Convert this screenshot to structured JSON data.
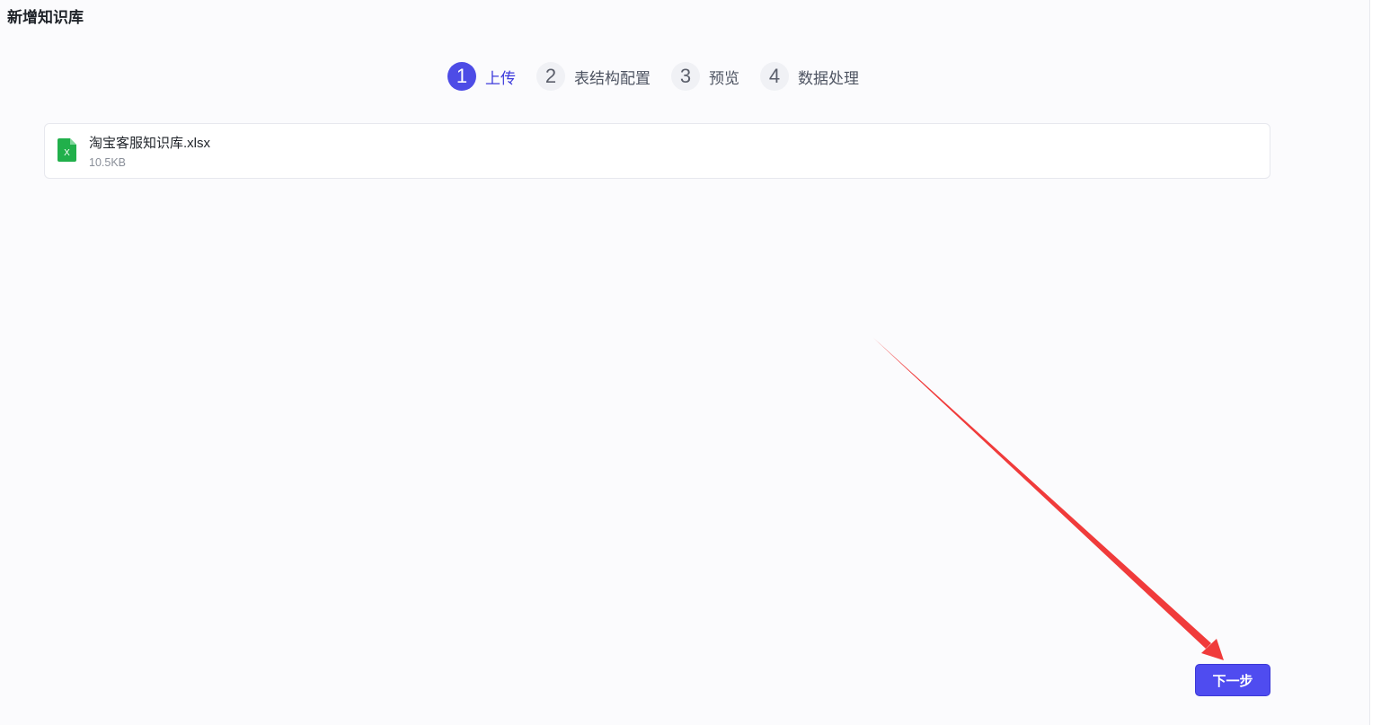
{
  "page": {
    "title": "新增知识库"
  },
  "steps": [
    {
      "number": "1",
      "label": "上传",
      "active": true
    },
    {
      "number": "2",
      "label": "表结构配置",
      "active": false
    },
    {
      "number": "3",
      "label": "预览",
      "active": false
    },
    {
      "number": "4",
      "label": "数据处理",
      "active": false
    }
  ],
  "file": {
    "name": "淘宝客服知识库.xlsx",
    "size": "10.5KB",
    "icon": "excel-file-icon",
    "icon_letter": "X",
    "icon_color": "#21b04b"
  },
  "actions": {
    "next_label": "下一步"
  },
  "colors": {
    "accent": "#4f4cf0",
    "annotation_arrow": "#f03b3b"
  }
}
